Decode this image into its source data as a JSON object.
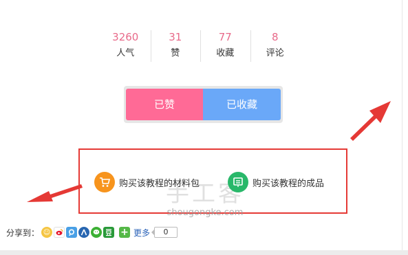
{
  "stats": [
    {
      "value": "3260",
      "label": "人气"
    },
    {
      "value": "31",
      "label": "赞"
    },
    {
      "value": "77",
      "label": "收藏"
    },
    {
      "value": "8",
      "label": "评论"
    }
  ],
  "actions": {
    "liked_label": "已赞",
    "favorited_label": "已收藏"
  },
  "purchase": {
    "materials_label": "购买该教程的材料包",
    "product_label": "购买该教程的成品"
  },
  "watermark": {
    "title": "手工客",
    "domain": "shougongke.com"
  },
  "share": {
    "label": "分享到：",
    "more_label": "更多",
    "count": "0"
  },
  "colors": {
    "like": "#ff6a96",
    "favorite": "#6aa8f8",
    "stat_number": "#e86a8a",
    "annotation": "#e53935",
    "materials_icon": "#f7941d",
    "product_icon": "#29b86a"
  },
  "icons": {
    "materials": "shopping-cart-icon",
    "product": "store-icon",
    "share": [
      "qzone-icon",
      "weibo-icon",
      "tencent-weibo-icon",
      "renren-icon",
      "wechat-icon",
      "douban-icon",
      "plus-icon"
    ]
  }
}
